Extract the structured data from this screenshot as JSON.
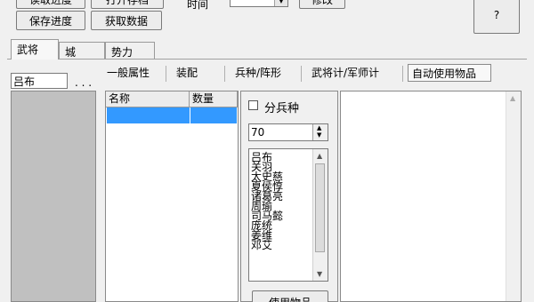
{
  "toolbar": {
    "top_left_clipped_label": "读取进度",
    "top_mid_clipped_label": "打开存档",
    "save_progress_label": "保存进度",
    "fetch_data_label": "获取数据",
    "time_label": "时间",
    "time_value": "",
    "modify_label": "修改",
    "help_label": "?"
  },
  "tabs": [
    {
      "label": "武将"
    },
    {
      "label": "城"
    },
    {
      "label": "势力"
    }
  ],
  "general": {
    "name_value": "吕布",
    "ellipsis": ". . ."
  },
  "subtabs": [
    {
      "label": "一般属性"
    },
    {
      "label": "装配"
    },
    {
      "label": "兵种/阵形"
    },
    {
      "label": "武将计/军师计"
    },
    {
      "label": "自动使用物品"
    }
  ],
  "item_table": {
    "columns": [
      "名称",
      "数量"
    ]
  },
  "split_troops": {
    "checkbox_label": "分兵种",
    "checked": false,
    "spinner_value": "70"
  },
  "general_list": [
    "吕布",
    "关羽",
    "太史慈",
    "夏侯惇",
    "诸葛亮",
    "周瑜",
    "司马懿",
    "庞统",
    "姜维",
    "邓艾"
  ],
  "use_item_label": "使用物品"
}
